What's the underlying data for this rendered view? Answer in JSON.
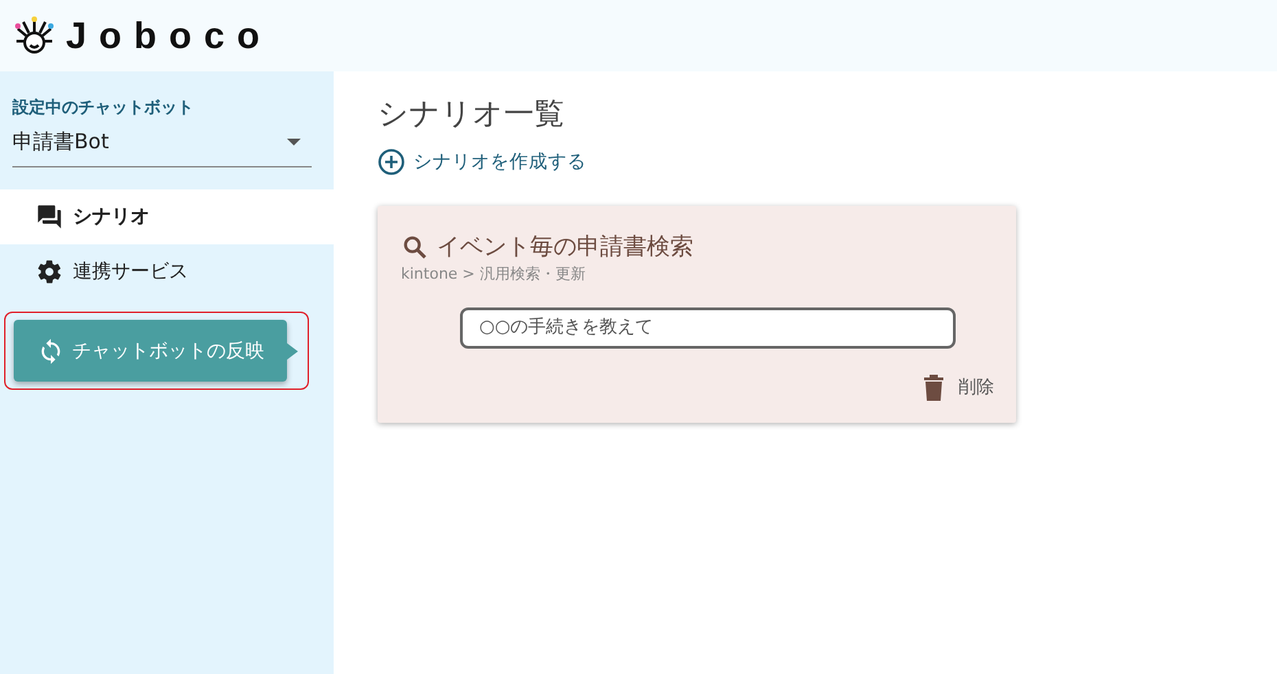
{
  "header": {
    "logo": "Joboco"
  },
  "sidebar": {
    "bot_label": "設定中のチャットボット",
    "bot_select": {
      "value": "申請書Bot"
    },
    "items": [
      {
        "label": "シナリオ",
        "selected": true
      },
      {
        "label": "連携サービス",
        "selected": false
      }
    ],
    "apply_button": "チャットボットの反映"
  },
  "main": {
    "title": "シナリオ一覧",
    "create_link": "シナリオを作成する",
    "cards": [
      {
        "title": "イベント毎の申請書検索",
        "path": "kintone > 汎用検索・更新",
        "utterance": "○○の手続きを教えて",
        "delete": "削除"
      }
    ]
  }
}
